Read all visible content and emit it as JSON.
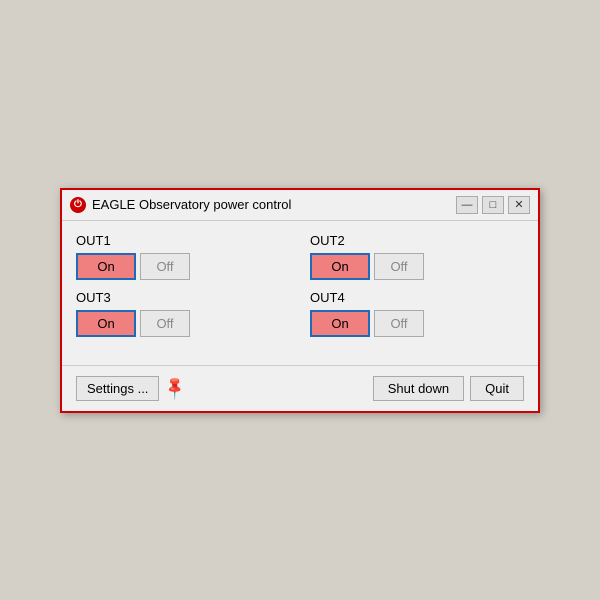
{
  "window": {
    "title": "EAGLE Observatory power control"
  },
  "titleButtons": {
    "minimize": "—",
    "maximize": "□",
    "close": "✕"
  },
  "outputs": [
    {
      "id": "out1",
      "label": "OUT1",
      "onLabel": "On",
      "offLabel": "Off",
      "state": "on"
    },
    {
      "id": "out2",
      "label": "OUT2",
      "onLabel": "On",
      "offLabel": "Off",
      "state": "on"
    },
    {
      "id": "out3",
      "label": "OUT3",
      "onLabel": "On",
      "offLabel": "Off",
      "state": "on"
    },
    {
      "id": "out4",
      "label": "OUT4",
      "onLabel": "On",
      "offLabel": "Off",
      "state": "on"
    }
  ],
  "footer": {
    "settingsLabel": "Settings ...",
    "shutdownLabel": "Shut down",
    "quitLabel": "Quit"
  }
}
